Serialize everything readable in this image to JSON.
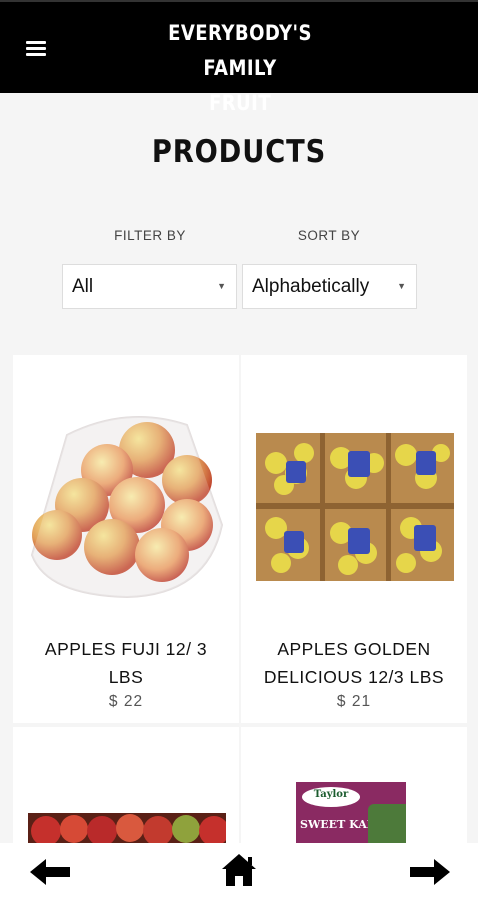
{
  "header": {
    "brand_line1": "EVERYBODY'S FAMILY",
    "brand_line2": "FRUIT",
    "menu_icon": "hamburger-menu-icon"
  },
  "page": {
    "title": "PRODUCTS"
  },
  "filter": {
    "label": "FILTER BY",
    "value": "All"
  },
  "sort": {
    "label": "SORT BY",
    "value": "Alphabetically"
  },
  "products": [
    {
      "name_line1": "APPLES FUJI 12/ 3",
      "name_line2": "LBS",
      "price": "$ 22",
      "image": "bag-of-apples-image"
    },
    {
      "name_line1": "APPLES GOLDEN",
      "name_line2": "DELICIOUS 12/3 LBS",
      "price": "$ 21",
      "image": "boxes-of-golden-apples-image"
    },
    {
      "image": "red-apples-image"
    },
    {
      "image": "sweet-kale-bag-image",
      "package_text": "SWEET KALE",
      "brand_text": "Taylor"
    }
  ],
  "bottom_nav": {
    "back_icon": "arrow-left-icon",
    "home_icon": "home-icon",
    "forward_icon": "arrow-right-icon"
  }
}
